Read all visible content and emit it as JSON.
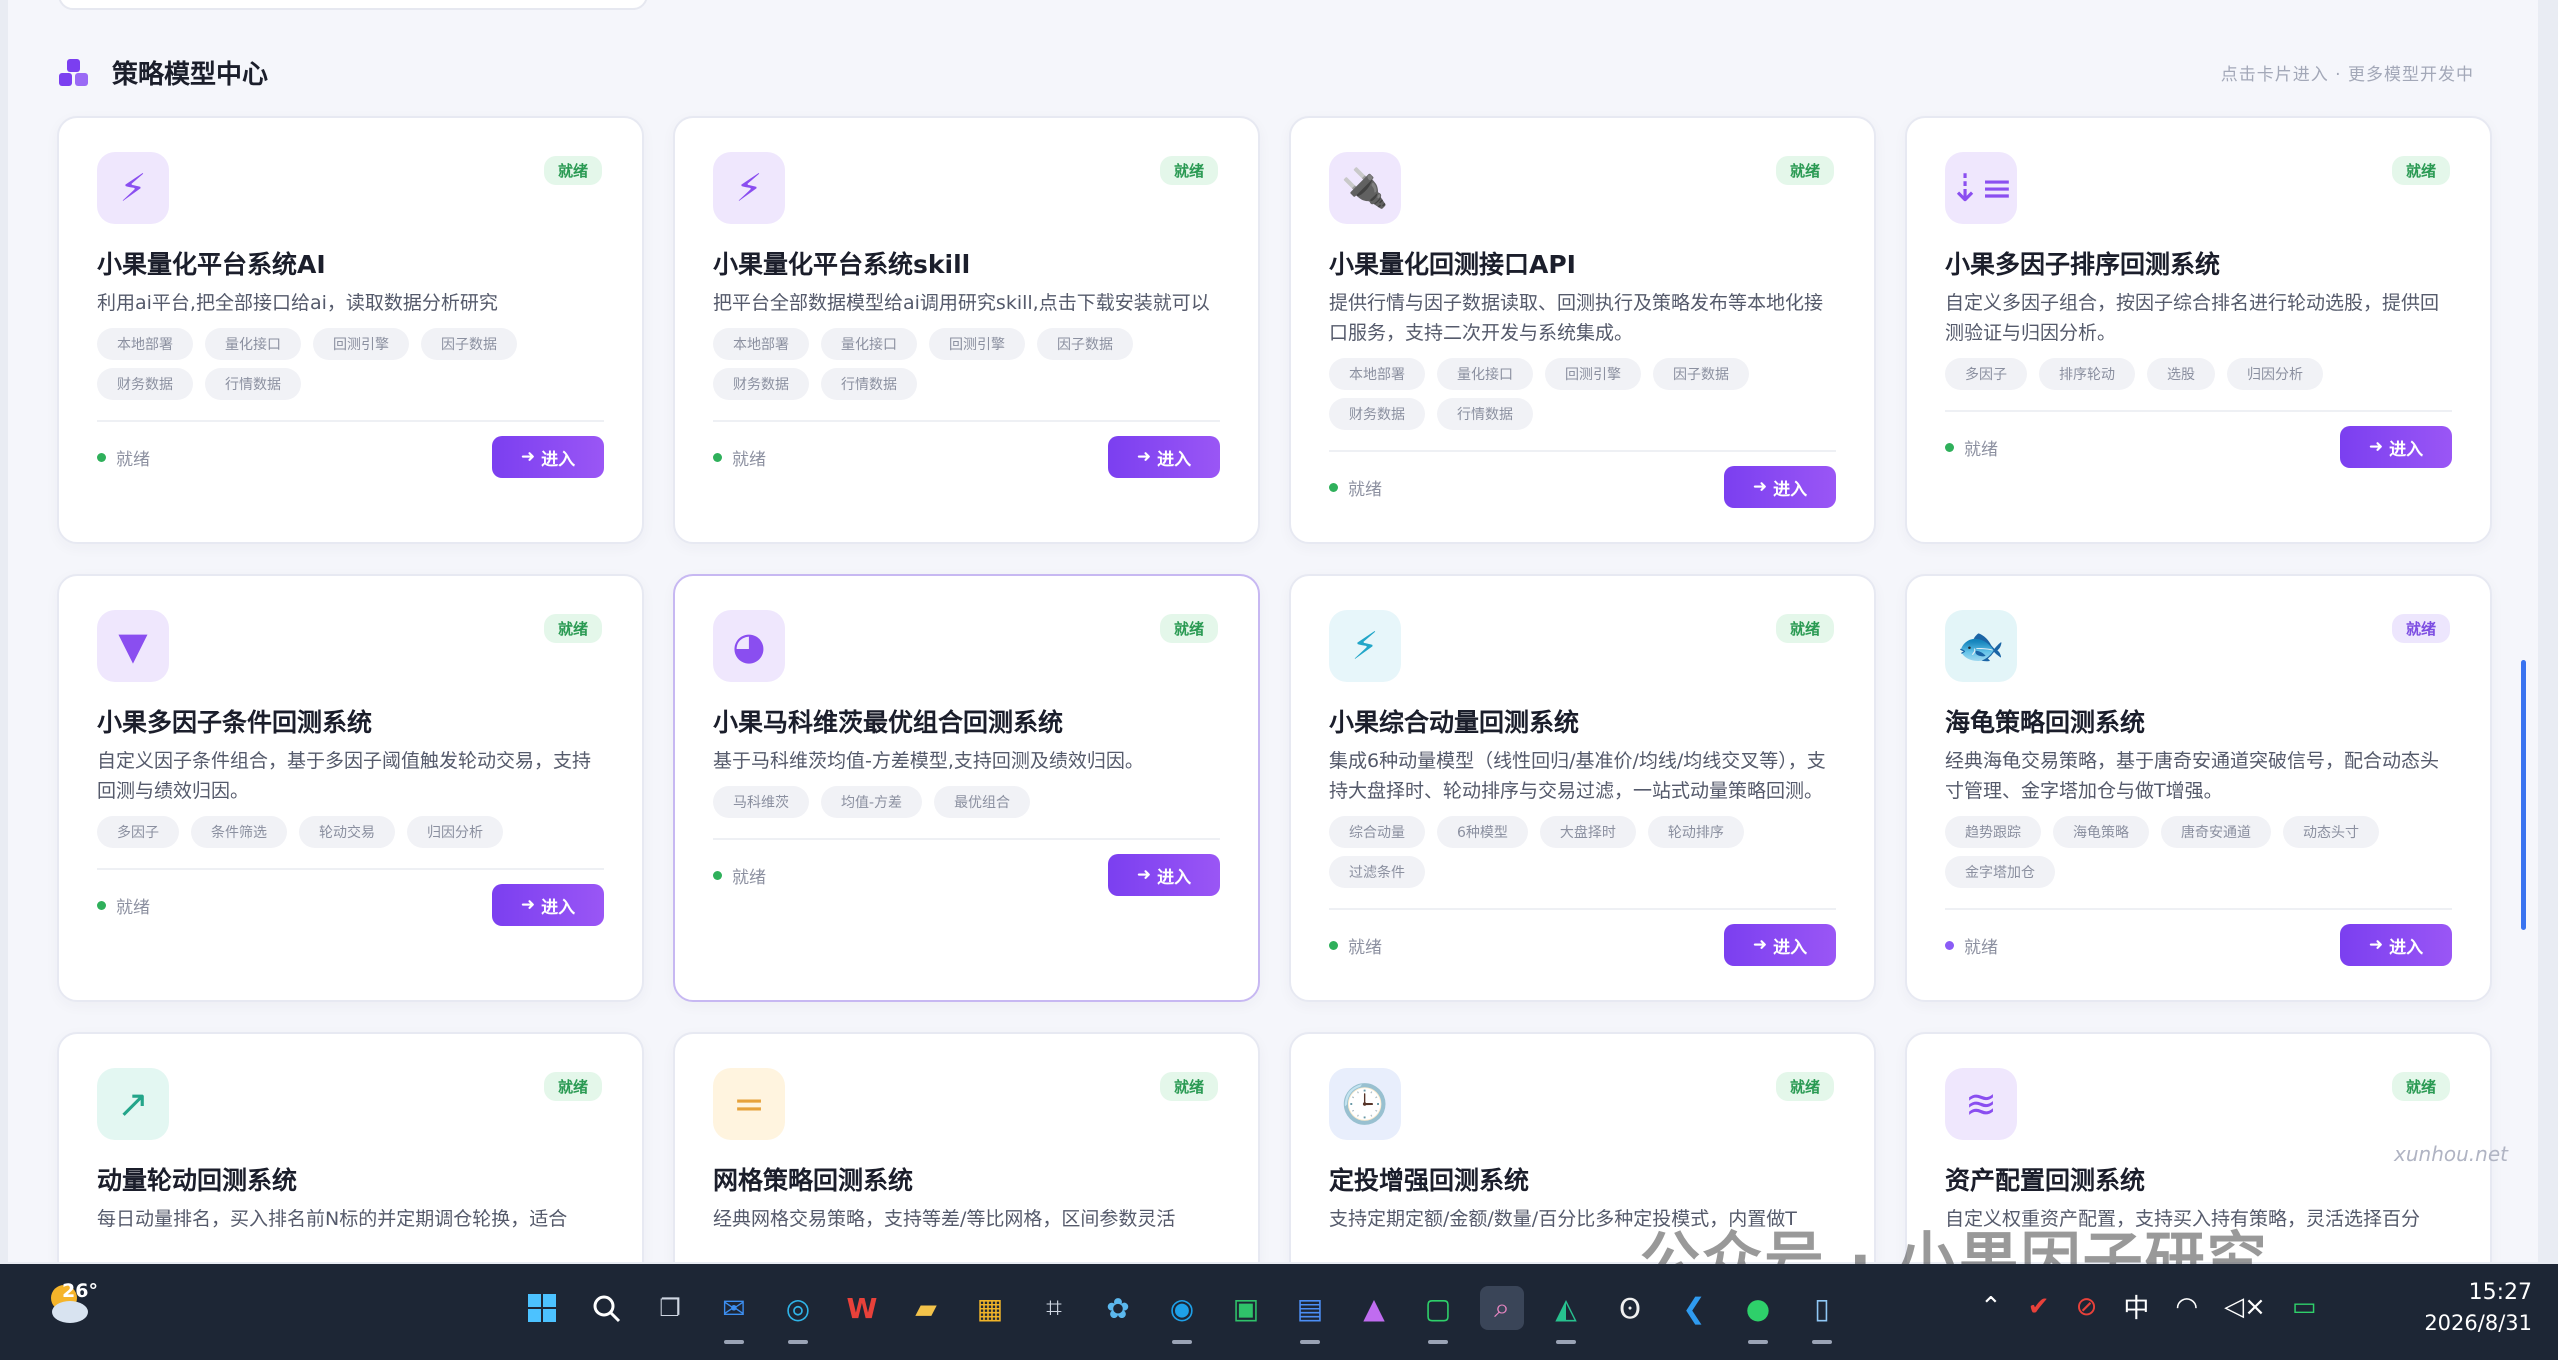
{
  "section": {
    "title": "策略模型中心",
    "hint": "点击卡片进入 · 更多模型开发中"
  },
  "cards": [
    {
      "icon": "lightning-icon",
      "glyph": "⚡",
      "icon_bg": "#efe7fd",
      "icon_color": "#8a4ef0",
      "badge": "就绪",
      "badge_style": "green",
      "title": "小果量化平台系统AI",
      "desc": "利用ai平台,把全部接口给ai，读取数据分析研究",
      "tags": [
        "本地部署",
        "量化接口",
        "回测引擎",
        "因子数据",
        "财务数据",
        "行情数据"
      ],
      "status": "就绪",
      "status_style": "green",
      "button": "进入"
    },
    {
      "icon": "lightning-icon",
      "glyph": "⚡",
      "icon_bg": "#efe7fd",
      "icon_color": "#8a4ef0",
      "badge": "就绪",
      "badge_style": "green",
      "title": "小果量化平台系统skill",
      "desc": "把平台全部数据模型给ai调用研究skill,点击下载安装就可以",
      "tags": [
        "本地部署",
        "量化接口",
        "回测引擎",
        "因子数据",
        "财务数据",
        "行情数据"
      ],
      "status": "就绪",
      "status_style": "green",
      "button": "进入"
    },
    {
      "icon": "plug-icon",
      "glyph": "🔌",
      "icon_bg": "#efe7fd",
      "icon_color": "#8a4ef0",
      "badge": "就绪",
      "badge_style": "green",
      "title": "小果量化回测接口API",
      "desc": "提供行情与因子数据读取、回测执行及策略发布等本地化接口服务，支持二次开发与系统集成。",
      "tags": [
        "本地部署",
        "量化接口",
        "回测引擎",
        "因子数据",
        "财务数据",
        "行情数据"
      ],
      "status": "就绪",
      "status_style": "green",
      "button": "进入"
    },
    {
      "icon": "sort-icon",
      "glyph": "⇣≡",
      "icon_bg": "#efe7fd",
      "icon_color": "#8a4ef0",
      "badge": "就绪",
      "badge_style": "green",
      "title": "小果多因子排序回测系统",
      "desc": "自定义多因子组合，按因子综合排名进行轮动选股，提供回测验证与归因分析。",
      "tags": [
        "多因子",
        "排序轮动",
        "选股",
        "归因分析"
      ],
      "status": "就绪",
      "status_style": "green",
      "button": "进入"
    },
    {
      "icon": "filter-icon",
      "glyph": "▼",
      "icon_bg": "#efe7fd",
      "icon_color": "#8a4ef0",
      "badge": "就绪",
      "badge_style": "green",
      "title": "小果多因子条件回测系统",
      "desc": "自定义因子条件组合，基于多因子阈值触发轮动交易，支持回测与绩效归因。",
      "tags": [
        "多因子",
        "条件筛选",
        "轮动交易",
        "归因分析"
      ],
      "status": "就绪",
      "status_style": "green",
      "button": "进入"
    },
    {
      "icon": "pie-chart-icon",
      "glyph": "◕",
      "icon_bg": "#efe7fd",
      "icon_color": "#8a4ef0",
      "badge": "就绪",
      "badge_style": "green",
      "title": "小果马科维茨最优组合回测系统",
      "desc": "基于马科维茨均值-方差模型,支持回测及绩效归因。",
      "tags": [
        "马科维茨",
        "均值-方差",
        "最优组合"
      ],
      "status": "就绪",
      "status_style": "green",
      "button": "进入"
    },
    {
      "icon": "bolt-icon",
      "glyph": "⚡",
      "icon_bg": "#e7f6fa",
      "icon_color": "#22a6c8",
      "badge": "就绪",
      "badge_style": "green",
      "title": "小果综合动量回测系统",
      "desc": "集成6种动量模型（线性回归/基准价/均线/均线交叉等），支持大盘择时、轮动排序与交易过滤，一站式动量策略回测。",
      "tags": [
        "综合动量",
        "6种模型",
        "大盘择时",
        "轮动排序",
        "过滤条件"
      ],
      "status": "就绪",
      "status_style": "green",
      "button": "进入"
    },
    {
      "icon": "fish-icon",
      "glyph": "🐟",
      "icon_bg": "#e3f5f8",
      "icon_color": "#22a6c8",
      "badge": "就绪",
      "badge_style": "purple",
      "title": "海龟策略回测系统",
      "desc": "经典海龟交易策略，基于唐奇安通道突破信号，配合动态头寸管理、金字塔加仓与做T增强。",
      "tags": [
        "趋势跟踪",
        "海龟策略",
        "唐奇安通道",
        "动态头寸",
        "金字塔加仓"
      ],
      "status": "就绪",
      "status_style": "purple",
      "button": "进入"
    },
    {
      "icon": "trend-up-icon",
      "glyph": "↗",
      "icon_bg": "#e3f7f2",
      "icon_color": "#23a58a",
      "badge": "就绪",
      "badge_style": "green",
      "title": "动量轮动回测系统",
      "desc": "每日动量排名，买入排名前N标的并定期调仓轮换，适合",
      "tags": [],
      "status": "",
      "status_style": "green",
      "button": ""
    },
    {
      "icon": "grid-icon",
      "glyph": "=",
      "icon_bg": "#fff4df",
      "icon_color": "#e6a23c",
      "badge": "就绪",
      "badge_style": "green",
      "title": "网格策略回测系统",
      "desc": "经典网格交易策略，支持等差/等比网格，区间参数灵活",
      "tags": [],
      "status": "",
      "status_style": "green",
      "button": ""
    },
    {
      "icon": "clock-icon",
      "glyph": "🕒",
      "icon_bg": "#e8eefc",
      "icon_color": "#3d63e0",
      "badge": "就绪",
      "badge_style": "green",
      "title": "定投增强回测系统",
      "desc": "支持定期定额/金额/数量/百分比多种定投模式，内置做T",
      "tags": [],
      "status": "",
      "status_style": "green",
      "button": ""
    },
    {
      "icon": "layers-icon",
      "glyph": "≋",
      "icon_bg": "#efe7fd",
      "icon_color": "#8a4ef0",
      "badge": "就绪",
      "badge_style": "green",
      "title": "资产配置回测系统",
      "desc": "自定义权重资产配置，支持买入持有策略，灵活选择百分",
      "tags": [],
      "status": "",
      "status_style": "green",
      "button": ""
    }
  ],
  "watermark": {
    "main": "公众号 · 小果因子研究",
    "site": "xunhou.net"
  },
  "taskbar": {
    "temperature": "26°",
    "ime": "中",
    "time": "15:27",
    "date": "2026/8/31"
  }
}
